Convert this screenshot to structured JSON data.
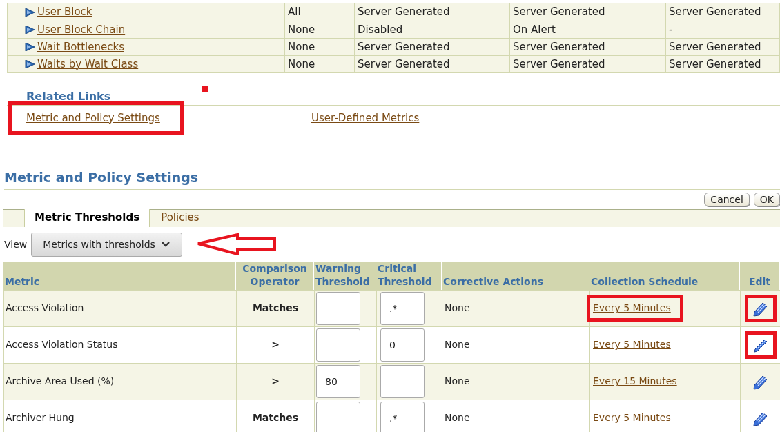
{
  "summary_table": {
    "rows": [
      {
        "name": "User Block",
        "cells": [
          "All",
          "Server Generated",
          "Server Generated",
          "Server Generated"
        ]
      },
      {
        "name": "User Block Chain",
        "cells": [
          "None",
          "Disabled",
          "On Alert",
          "-"
        ]
      },
      {
        "name": "Wait Bottlenecks",
        "cells": [
          "None",
          "Server Generated",
          "Server Generated",
          "Server Generated"
        ]
      },
      {
        "name": "Waits by Wait Class",
        "cells": [
          "None",
          "Server Generated",
          "Server Generated",
          "Server Generated"
        ]
      }
    ]
  },
  "related_links": {
    "title": "Related Links",
    "links": [
      {
        "label": "Metric and Policy Settings",
        "highlighted": true
      },
      {
        "label": "User-Defined Metrics",
        "highlighted": false
      }
    ]
  },
  "section": {
    "title": "Metric and Policy Settings",
    "buttons": [
      "Cancel",
      "OK"
    ],
    "tabs": [
      {
        "label": "Metric Thresholds",
        "selected": true
      },
      {
        "label": "Policies",
        "selected": false
      }
    ],
    "view": {
      "label": "View",
      "value": "Metrics with thresholds"
    }
  },
  "metrics_table": {
    "columns": [
      "Metric",
      "Comparison Operator",
      "Warning Threshold",
      "Critical Threshold",
      "Corrective Actions",
      "Collection Schedule",
      "Edit"
    ],
    "rows": [
      {
        "metric": "Access Violation",
        "operator": "Matches",
        "operator_bold": true,
        "warning": "",
        "critical": ".*",
        "actions": "None",
        "schedule": "Every 5 Minutes",
        "schedule_highlighted": true,
        "edit": {
          "kind": "pencils",
          "highlighted": true
        }
      },
      {
        "metric": "Access Violation Status",
        "operator": ">",
        "operator_bold": true,
        "warning": "",
        "critical": "0",
        "actions": "None",
        "schedule": "Every 5 Minutes",
        "schedule_highlighted": false,
        "edit": {
          "kind": "pencil",
          "highlighted": true
        }
      },
      {
        "metric": "Archive Area Used (%)",
        "operator": ">",
        "operator_bold": true,
        "warning": "80",
        "critical": "",
        "actions": "None",
        "schedule": "Every 15 Minutes",
        "schedule_highlighted": false,
        "edit": {
          "kind": "pencils",
          "highlighted": false
        }
      },
      {
        "metric": "Archiver Hung",
        "operator": "Matches",
        "operator_bold": true,
        "warning": "",
        "critical": ".*",
        "actions": "None",
        "schedule": "Every 5 Minutes",
        "schedule_highlighted": false,
        "edit": {
          "kind": "pencils",
          "highlighted": false
        }
      }
    ]
  }
}
